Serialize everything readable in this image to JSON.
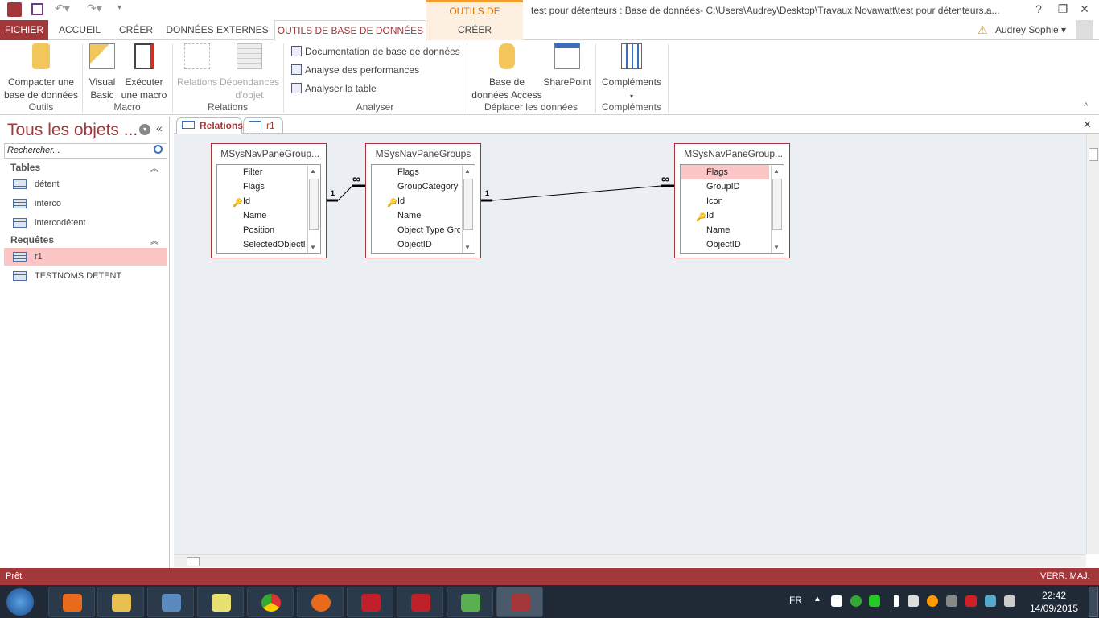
{
  "titlebar": {
    "context_label": "OUTILS DE RELATION",
    "title": "test pour détenteurs : Base de données- C:\\Users\\Audrey\\Desktop\\Travaux Novawatt\\test pour détenteurs.a...",
    "help": "?",
    "minimize": "–",
    "restore": "❐",
    "close": "✕"
  },
  "tabs": [
    {
      "label": "FICHIER"
    },
    {
      "label": "ACCUEIL"
    },
    {
      "label": "CRÉER"
    },
    {
      "label": "DONNÉES EXTERNES"
    },
    {
      "label": "OUTILS DE BASE DE DONNÉES"
    },
    {
      "label": "CRÉER"
    }
  ],
  "user": {
    "name": "Audrey Sophie ▾",
    "warning": "⚠"
  },
  "ribbon": {
    "compact": "Compacter une base de données",
    "vb": "Visual Basic",
    "macro": "Exécuter une macro",
    "relations": "Relations",
    "deps": "Dépendances d'objet",
    "doc": "Documentation de base de données",
    "perf": "Analyse des performances",
    "analyze": "Analyser la table",
    "access": "Base de données Access",
    "sharepoint": "SharePoint",
    "addins": "Compléments",
    "addins_arrow": "▾",
    "groups": {
      "tools": "Outils",
      "macro": "Macro",
      "relations": "Relations",
      "analyze": "Analyser",
      "move": "Déplacer les données",
      "addins": "Compléments"
    },
    "collapse": "^"
  },
  "nav": {
    "title": "Tous les objets ...",
    "search_placeholder": "Rechercher...",
    "tables_label": "Tables",
    "tables": [
      "détent",
      "interco",
      "intercodétent"
    ],
    "queries_label": "Requêtes",
    "queries": [
      "r1",
      "TESTNOMS DETENT"
    ],
    "selected": "r1"
  },
  "doctabs": [
    {
      "label": "Relations",
      "active": true
    },
    {
      "label": "r1",
      "active": false
    }
  ],
  "doc_close": "✕",
  "tables": [
    {
      "name": "MSysNavPaneGroup...",
      "fields": [
        "Filter",
        "Flags",
        "Id",
        "Name",
        "Position",
        "SelectedObjectI"
      ],
      "key": "Id"
    },
    {
      "name": "MSysNavPaneGroups",
      "fields": [
        "Flags",
        "GroupCategory",
        "Id",
        "Name",
        "Object Type Gro",
        "ObjectID"
      ],
      "key": "Id"
    },
    {
      "name": "MSysNavPaneGroup...",
      "fields": [
        "Flags",
        "GroupID",
        "Icon",
        "Id",
        "Name",
        "ObjectID"
      ],
      "key": "Id",
      "highlighted": "Flags"
    }
  ],
  "relationships": [
    {
      "one": "1",
      "many": "∞"
    },
    {
      "one": "1",
      "many": "∞"
    }
  ],
  "status": {
    "left": "Prêt",
    "right": "VERR. MAJ."
  },
  "taskbar": {
    "lang": "FR",
    "time": "22:42",
    "date": "14/09/2015"
  },
  "colors": {
    "accent": "#a4373a",
    "context": "#e07000",
    "selection": "#fcc6c6"
  }
}
